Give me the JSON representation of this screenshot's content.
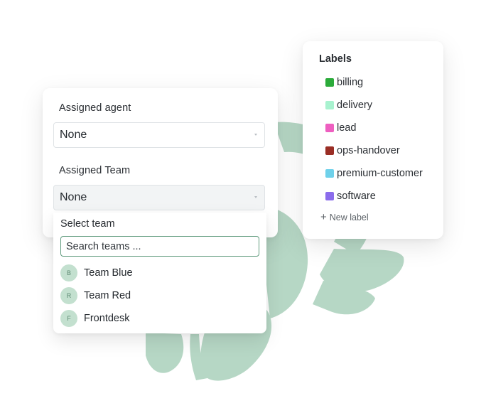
{
  "colors": {
    "leaf_green": "#b6d7c5",
    "accent_green": "#5f9b7d",
    "avatar_bg": "#c3e0cf"
  },
  "assignment": {
    "agent": {
      "label": "Assigned agent",
      "value": "None"
    },
    "team": {
      "label": "Assigned Team",
      "value": "None"
    }
  },
  "team_dropdown": {
    "title": "Select team",
    "search_placeholder": "Search teams ...",
    "teams": [
      {
        "initial": "B",
        "name": "Team Blue"
      },
      {
        "initial": "R",
        "name": "Team Red"
      },
      {
        "initial": "F",
        "name": "Frontdesk"
      }
    ]
  },
  "labels_panel": {
    "title": "Labels",
    "labels": [
      {
        "name": "billing",
        "color": "#2bab3a"
      },
      {
        "name": "delivery",
        "color": "#a8f2cf"
      },
      {
        "name": "lead",
        "color": "#ee5fc0"
      },
      {
        "name": "ops-handover",
        "color": "#9a2e25"
      },
      {
        "name": "premium-customer",
        "color": "#6fd1ea"
      },
      {
        "name": "software",
        "color": "#8b6cec"
      }
    ],
    "new_label": "New label"
  }
}
